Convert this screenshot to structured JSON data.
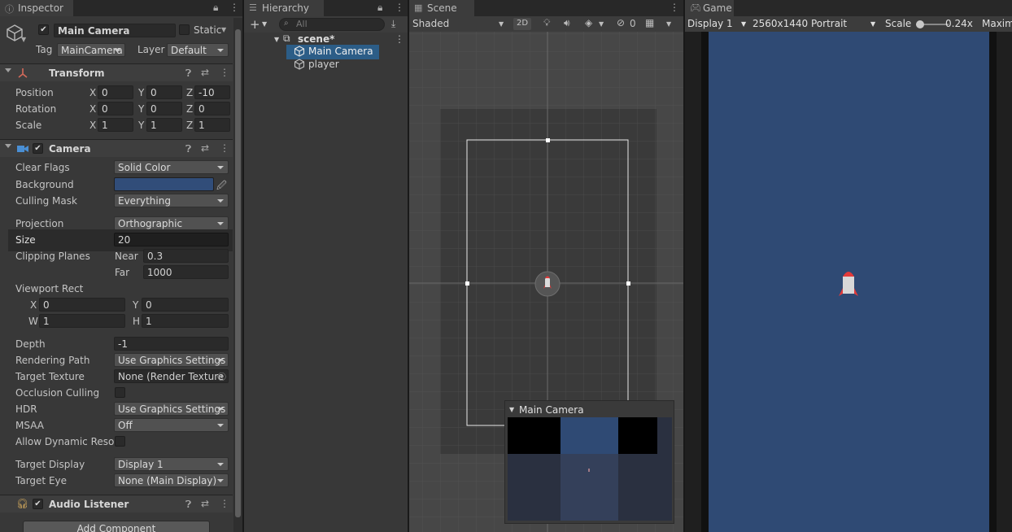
{
  "inspector": {
    "tab": "Inspector",
    "object_name": "Main Camera",
    "static_label": "Static",
    "tag_label": "Tag",
    "tag_value": "MainCamera",
    "layer_label": "Layer",
    "layer_value": "Default",
    "transform": {
      "title": "Transform",
      "rows": [
        {
          "label": "Position",
          "x": "0",
          "y": "0",
          "z": "-10"
        },
        {
          "label": "Rotation",
          "x": "0",
          "y": "0",
          "z": "0"
        },
        {
          "label": "Scale",
          "x": "1",
          "y": "1",
          "z": "1"
        }
      ],
      "axis": {
        "x": "X",
        "y": "Y",
        "z": "Z"
      }
    },
    "camera": {
      "title": "Camera",
      "clear_flags_label": "Clear Flags",
      "clear_flags": "Solid Color",
      "background_label": "Background",
      "background_color": "#314D79",
      "culling_mask_label": "Culling Mask",
      "culling_mask": "Everything",
      "projection_label": "Projection",
      "projection": "Orthographic",
      "size_label": "Size",
      "size": "20",
      "clipping_label": "Clipping Planes",
      "near_label": "Near",
      "near": "0.3",
      "far_label": "Far",
      "far": "1000",
      "viewport_label": "Viewport Rect",
      "vp_x_label": "X",
      "vp_x": "0",
      "vp_y_label": "Y",
      "vp_y": "0",
      "vp_w_label": "W",
      "vp_w": "1",
      "vp_h_label": "H",
      "vp_h": "1",
      "depth_label": "Depth",
      "depth": "-1",
      "rendering_path_label": "Rendering Path",
      "rendering_path": "Use Graphics Settings",
      "target_texture_label": "Target Texture",
      "target_texture": "None (Render Texture",
      "occlusion_label": "Occlusion Culling",
      "hdr_label": "HDR",
      "hdr": "Use Graphics Settings",
      "msaa_label": "MSAA",
      "msaa": "Off",
      "dynamic_res_label": "Allow Dynamic Resol",
      "target_display_label": "Target Display",
      "target_display": "Display 1",
      "target_eye_label": "Target Eye",
      "target_eye": "None (Main Display)"
    },
    "audio_listener": "Audio Listener",
    "add_component": "Add Component"
  },
  "hierarchy": {
    "tab": "Hierarchy",
    "search_placeholder": "All",
    "scene": "scene*",
    "items": [
      "Main Camera",
      "player"
    ]
  },
  "scene_view": {
    "tab": "Scene",
    "shading": "Shaded",
    "mode_2d": "2D",
    "gizmo_count": "0",
    "preview_title": "Main Camera"
  },
  "game_view": {
    "tab": "Game",
    "display": "Display 1",
    "resolution": "2560x1440 Portrait",
    "scale_label": "Scale",
    "scale_value": "0.24x",
    "maximize": "Maxim",
    "background_color": "#2F4A74"
  }
}
